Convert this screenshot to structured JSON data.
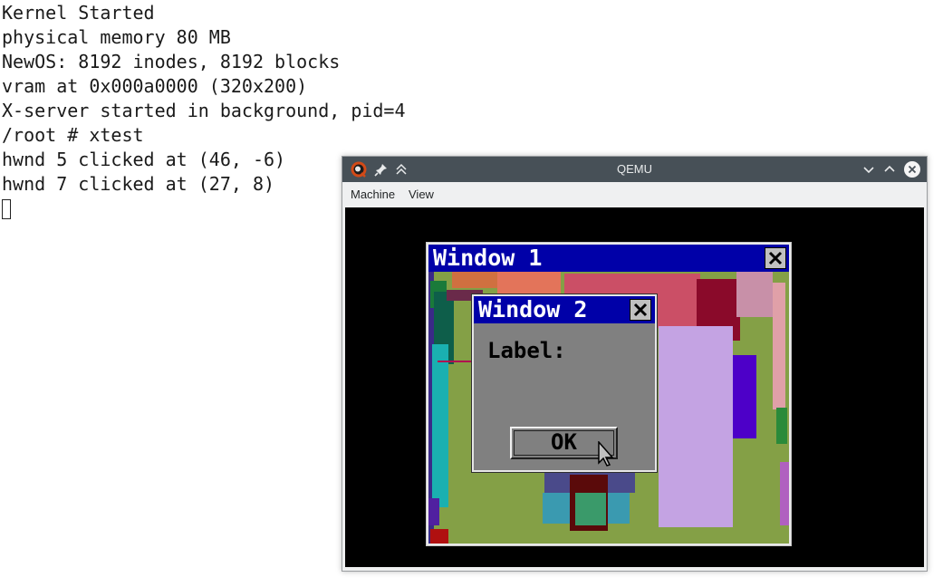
{
  "terminal": {
    "lines": [
      "Kernel Started",
      "physical memory 80 MB",
      "NewOS: 8192 inodes, 8192 blocks",
      "vram at 0x000a0000 (320x200)",
      "X-server started in background, pid=4",
      "/root # xtest",
      "hwnd 5 clicked at (46, -6)",
      "hwnd 7 clicked at (27, 8)"
    ]
  },
  "qemu": {
    "title": "QEMU",
    "app_icon": "qemu-logo-icon",
    "titlebar_icons": [
      "pin-icon",
      "keep-above-icon",
      "minimize-icon",
      "maximize-icon",
      "close-icon"
    ],
    "menu": [
      "Machine",
      "View"
    ],
    "colors": {
      "titlebar": "#475057",
      "menubar": "#eff0f1",
      "screen": "#000000"
    }
  },
  "guest": {
    "window1": {
      "title": "Window 1",
      "titlebar_color": "#0000a8"
    },
    "window2": {
      "title": "Window 2",
      "label": "Label:",
      "ok_button": "OK",
      "titlebar_color": "#0000a8",
      "body_color": "#808080"
    },
    "cursor_icon": "mouse-pointer-icon"
  }
}
